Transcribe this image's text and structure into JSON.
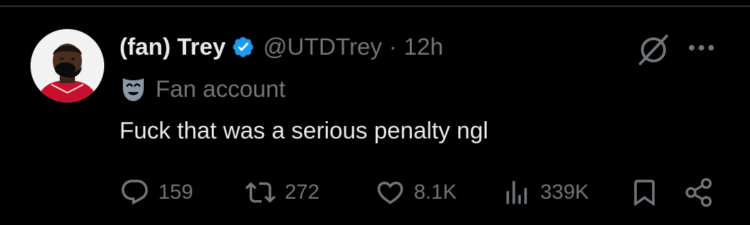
{
  "tweet": {
    "author": {
      "display_name": "(fan) Trey",
      "handle": "@UTDTrey",
      "verified_icon": "verified-badge-icon",
      "verified_color": "#1d9bf0"
    },
    "separator": "·",
    "time": "12h",
    "affiliation": {
      "icon": "theater-mask-icon",
      "label": "Fan account"
    },
    "text": "Fuck that was a serious penalty ngl",
    "actions": {
      "replies": "159",
      "retweets": "272",
      "likes": "8.1K",
      "views": "339K"
    }
  },
  "colors": {
    "background": "#000000",
    "primary_text": "#e7e9ea",
    "secondary_text": "#71767b",
    "divider": "#2f3336"
  }
}
